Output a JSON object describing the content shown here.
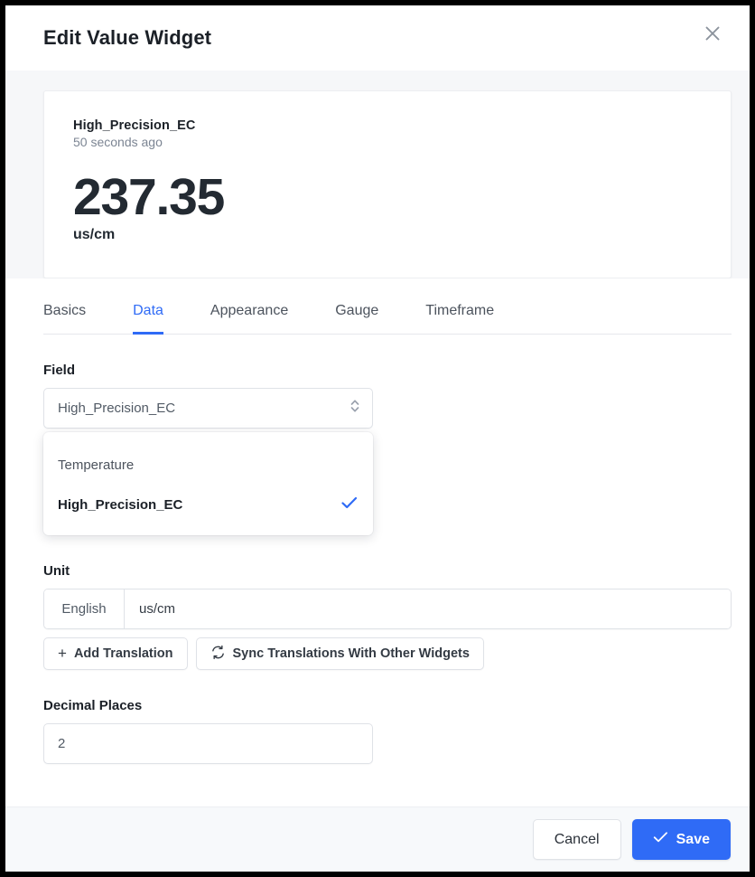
{
  "modal": {
    "title": "Edit Value Widget",
    "close_icon": "close-icon"
  },
  "preview": {
    "field_name": "High_Precision_EC",
    "timestamp": "50 seconds ago",
    "value": "237.35",
    "unit": "us/cm"
  },
  "tabs": [
    {
      "label": "Basics",
      "active": false
    },
    {
      "label": "Data",
      "active": true
    },
    {
      "label": "Appearance",
      "active": false
    },
    {
      "label": "Gauge",
      "active": false
    },
    {
      "label": "Timeframe",
      "active": false
    }
  ],
  "field_section": {
    "label": "Field",
    "selected": "High_Precision_EC",
    "stepper_icon": "chevron-up-down-icon",
    "options": [
      {
        "label": "Temperature",
        "selected": false
      },
      {
        "label": "High_Precision_EC",
        "selected": true
      }
    ],
    "check_icon": "check-icon"
  },
  "unit_section": {
    "label": "Unit",
    "language": "English",
    "value": "us/cm",
    "placeholder": "",
    "add_translation_label": "Add Translation",
    "add_translation_icon": "plus-icon",
    "sync_label": "Sync Translations With Other Widgets",
    "sync_icon": "sync-icon"
  },
  "decimal_section": {
    "label": "Decimal Places",
    "value": "2",
    "placeholder": ""
  },
  "footer": {
    "cancel_label": "Cancel",
    "save_label": "Save",
    "save_icon": "check-icon"
  },
  "colors": {
    "accent": "#2f6bf6",
    "preview_bg": "#f6f7f9",
    "footer_bg": "#f7f9fb",
    "text_primary": "#1b2027",
    "text_muted": "#7c8593",
    "border": "#dfe2e7"
  }
}
